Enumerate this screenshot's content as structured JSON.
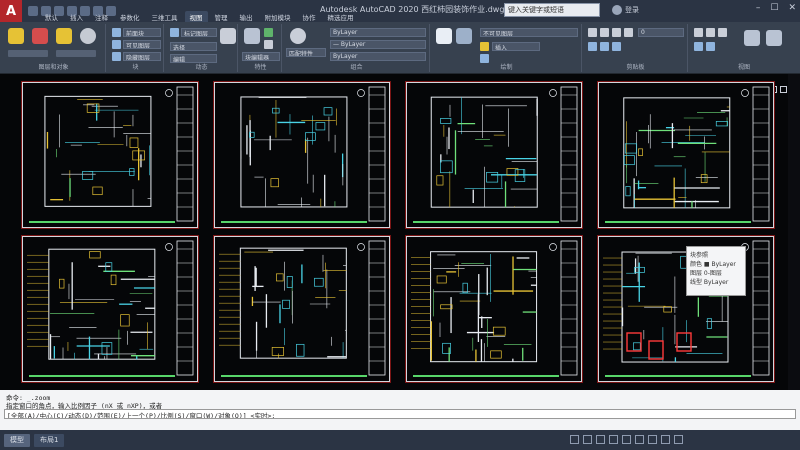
{
  "window": {
    "app_logo": "A",
    "title": "Autodesk AutoCAD 2020   西红柿园装饰作业.dwg",
    "search_placeholder": "键入关键字或短语",
    "login_label": "登录",
    "controls": [
      "–",
      "☐",
      "✕"
    ]
  },
  "tabs": [
    {
      "label": "默认",
      "active": false
    },
    {
      "label": "插入",
      "active": false
    },
    {
      "label": "注释",
      "active": false
    },
    {
      "label": "参数化",
      "active": false
    },
    {
      "label": "三维工具",
      "active": false
    },
    {
      "label": "视图",
      "active": true
    },
    {
      "label": "管理",
      "active": false
    },
    {
      "label": "输出",
      "active": false
    },
    {
      "label": "附加模块",
      "active": false
    },
    {
      "label": "协作",
      "active": false
    },
    {
      "label": "精选应用",
      "active": false
    }
  ],
  "ribbon": {
    "groups": [
      {
        "label": "图层和对象"
      },
      {
        "label": "块"
      },
      {
        "label": "动态"
      },
      {
        "label": "特性"
      },
      {
        "label": "组合"
      },
      {
        "label": "绘制"
      },
      {
        "label": "剪贴板"
      },
      {
        "label": "视图"
      }
    ],
    "buttons": [
      "前面块",
      "可见图层",
      "隐藏图层",
      "标记图层",
      "选择",
      "编辑",
      "块编辑器",
      "匹配特性"
    ],
    "combos": [
      "ByLayer",
      "— ByLayer",
      "ByLayer",
      "不可见图层",
      "插入",
      "0"
    ]
  },
  "tooltip": {
    "title": "块参照",
    "rows": [
      "颜色  ■ ByLayer",
      "图层  0-图层",
      "线型  ByLayer"
    ]
  },
  "command": {
    "lines": [
      "命令: _.zoom",
      "指定窗口的角点，输入比例因子 (nX 或 nXP)，或者"
    ],
    "prompt": "[全部(A)/中心(C)/动态(D)/范围(E)/上一个(P)/比例(S)/窗口(W)/对象(O)] <实时>:"
  },
  "status": {
    "tabs": [
      "模型",
      "布局1"
    ],
    "active": "模型"
  },
  "colors": {
    "titlebar": "#2b3444",
    "ribbon": "#37414f",
    "canvas": "#050608",
    "accent_red": "#b3262b"
  }
}
